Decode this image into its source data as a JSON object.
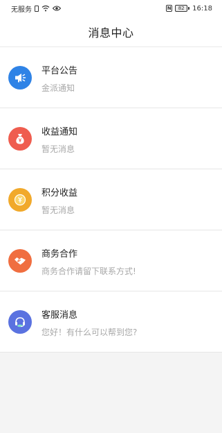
{
  "status_bar": {
    "carrier": "无服务",
    "battery": "82",
    "time": "16:18"
  },
  "header": {
    "title": "消息中心"
  },
  "messages": [
    {
      "title": "平台公告",
      "preview": "金派通知",
      "icon": "megaphone-icon",
      "color": "#2f83e6"
    },
    {
      "title": "收益通知",
      "preview": "暂无消息",
      "icon": "money-bag-icon",
      "color": "#ef5d4f"
    },
    {
      "title": "积分收益",
      "preview": "暂无消息",
      "icon": "coin-icon",
      "color": "#f1a92b"
    },
    {
      "title": "商务合作",
      "preview": "商务合作请留下联系方式!",
      "icon": "handshake-icon",
      "color": "#f06e40"
    },
    {
      "title": "客服消息",
      "preview": "您好！有什么可以帮到您?",
      "icon": "headset-icon",
      "color": "#5a72e0"
    }
  ]
}
